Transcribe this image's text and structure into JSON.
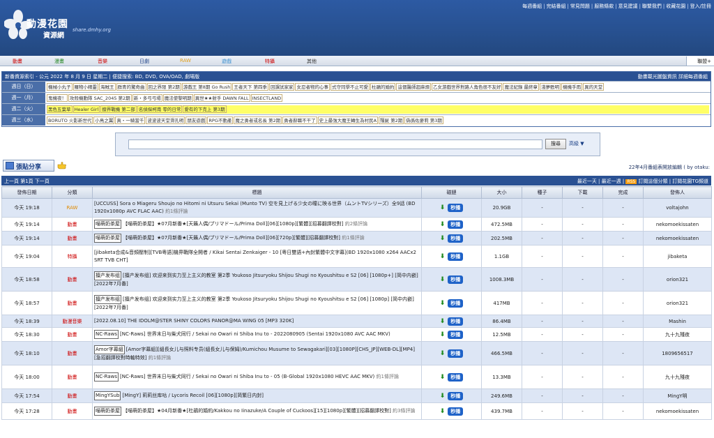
{
  "header": {
    "logo_main": "動漫花園",
    "logo_sub": "資源網",
    "logo_url": "share.dmhy.org",
    "links": [
      "每週番組",
      "完結番組",
      "常見問題",
      "服務條款",
      "意見建議",
      "聯繫我們",
      "收藏花園",
      "登入/註冊"
    ]
  },
  "categories": [
    "動畫",
    "漫畫",
    "音樂",
    "日劇",
    "RAW",
    "遊戲",
    "特攝",
    "其他"
  ],
  "category_colors": [
    "#cc0000",
    "#2a8a2a",
    "#cc0000",
    "#1a3f85",
    "#e0a020",
    "#3a8fd0",
    "#cc0000",
    "#333333"
  ],
  "nav_right": "聯盟+",
  "schedule": {
    "title": "新番資源索引 - 公元 2022 年 8 月 9 日 星期二 | 便捷搜索: BD, DVD, OVA/OAD, 劇場版",
    "title_right": "動畫載光圖盤資訊 詳細每週番組",
    "rows": [
      {
        "day": "週日（日）",
        "items": [
          "機械小丸子",
          "羅物小精靈",
          "海賊王",
          "群青的驚奇曲",
          "回之界限 第2期",
          "游戲王 第8期 Go Rush",
          "王者天下 第四季",
          "回課試家家",
          "女忍者物的心事",
          "式守同學不止可愛",
          "杜鵑的婚約",
          "這個醫師超麻煩",
          "乙女游戲世界對路人角色很不友好",
          "魔法紀錄 最終章",
          "淺夢甦明",
          "機機手雨",
          "異的天堂"
        ]
      },
      {
        "day": "週一（月）",
        "items": [
          "鬼機夜！",
          "攻殼機動隊 SAC_2045 第2期",
          "新・多弓弓場",
          "魔法使黎明期",
          "異世★★射手 DAWN FALL",
          "INSECTLAND"
        ]
      },
      {
        "day": "週二（火）",
        "items": [
          "黑色五葉草",
          "Healer Girl",
          "擅界戰機 第二部",
          "名偵探柯南 零的日常",
          "愛有的下克上 第3期"
        ]
      },
      {
        "day": "週三（水）",
        "items": [
          "BORUTO 火影新世代",
          "小鳥之翼",
          "真・一騎當千",
          "波波波天堂滑孔明",
          "朋友遊戲",
          "RPG不動產",
          "魔之勇者或名長 第2期",
          "勇者辭職不干了",
          "史上最強大魔王轉生為村民A",
          "殭屍 第2期",
          "偽僞佐麥莉 第3期"
        ]
      }
    ]
  },
  "search": {
    "button": "搜尋",
    "advanced": "高級 ▼",
    "placeholder": ""
  },
  "paste_button": "張貼分享",
  "notice": "22年4月番組表開放編輯 ( by otaku:",
  "pager": {
    "left": "上一頁 第1頁 下一頁",
    "right": [
      "最近一天",
      "最近一週",
      "訂閱這個分類",
      "訂閱花園TG頻道"
    ],
    "rss": "RSS"
  },
  "table": {
    "headers": [
      "發佈日期",
      "分類",
      "標題",
      "磁鏈",
      "大小",
      "種子",
      "下載",
      "完成",
      "發佈人"
    ],
    "seed_label": "秒播",
    "rows": [
      {
        "date": "今天 19:18",
        "cat": "RAW",
        "cat_class": "c-raw",
        "tag": "",
        "title": "[UCCUSS] Sora o Miageru Shoujo no Hitomi ni Utsuru Sekai (Munto TV) 空を見上げる少女の瞳に映る世界（ムントTVシリーズ）全9話 (BD 1920x1080p AVC FLAC AAC)",
        "comment": "約1條評論",
        "size": "20.9GB",
        "seed": "-",
        "dl": "-",
        "done": "-",
        "user": "voltajohn"
      },
      {
        "date": "今天 19:14",
        "cat": "動畫",
        "cat_class": "c-red",
        "tag": "喵萌奶茶屋",
        "title": "【喵萌奶茶屋】★07月新番★[天籟人偶/プリマドール/Prima Doll][06][1080p][繁體][招募翻譯校對]",
        "comment": "約2條評論",
        "size": "472.5MB",
        "seed": "-",
        "dl": "-",
        "done": "-",
        "user": "nekomoekissaten"
      },
      {
        "date": "今天 19:14",
        "cat": "動畫",
        "cat_class": "c-red",
        "tag": "喵萌奶茶屋",
        "title": "【喵萌奶茶屋】★07月新番★[天籟人偶/プリマドール/Prima Doll][06][720p][繁體][招募翻譯校對]",
        "comment": "約1條評論",
        "size": "202.5MB",
        "seed": "-",
        "dl": "-",
        "done": "-",
        "user": "nekomoekissaten"
      },
      {
        "date": "今天 19:04",
        "cat": "特攝",
        "cat_class": "c-tokusatsu",
        "tag": "",
        "title": "[jibaketa合成&音頻壓制][TVB粵語]機界戰隊全開者 / Kikai Sentai Zenkaiger - 10 [粵日雙語+內封繁體中文字幕](BD 1920x1080 x264 AACx2 SRT TVB CHT]",
        "comment": "",
        "size": "1.1GB",
        "seed": "-",
        "dl": "-",
        "done": "-",
        "user": "jibaketa"
      },
      {
        "date": "今天 18:58",
        "cat": "動畫",
        "cat_class": "c-red",
        "tag": "擅产发布组",
        "title": "[擅产发布组] 欢迎来到实力至上主义的教室 第2季 Youkoso Jitsuryoku Shijou Shugi no Kyoushitsu e S2 [06] [1080p+] [简中内嵌] [2022年7月番]",
        "comment": "",
        "size": "1008.3MB",
        "seed": "-",
        "dl": "-",
        "done": "-",
        "user": "orion321"
      },
      {
        "date": "今天 18:57",
        "cat": "動畫",
        "cat_class": "c-red",
        "tag": "擅产发布组",
        "title": "[擅产发布组] 欢迎来到实力至上主义的教室 第2季 Youkoso Jitsuryoku Shijou Shugi no Kyoushitsu e S2 [06] [1080p] [简中内嵌] [2022年7月番]",
        "comment": "",
        "size": "417MB",
        "seed": "-",
        "dl": "-",
        "done": "-",
        "user": "orion321"
      },
      {
        "date": "今天 18:39",
        "cat": "動漫音樂",
        "cat_class": "c-music",
        "tag": "",
        "title": "[2022.08.10] THE IDOLM@STER SHINY COLORS PANOR@MA WING 05 [MP3 320K]",
        "comment": "",
        "size": "86.4MB",
        "seed": "-",
        "dl": "-",
        "done": "-",
        "user": "Mashin"
      },
      {
        "date": "今天 18:30",
        "cat": "動畫",
        "cat_class": "c-red",
        "tag": "NC-Raws",
        "title": "[NC-Raws] 世界末日与柴犬同行 / Sekai no Owari ni Shiba Inu to - 2022080905 (Sentai 1920x1080 AVC AAC MKV)",
        "comment": "",
        "size": "12.5MB",
        "seed": "-",
        "dl": "-",
        "done": "-",
        "user": "九十九殘夜"
      },
      {
        "date": "今天 18:10",
        "cat": "動畫",
        "cat_class": "c-red",
        "tag": "Amor字幕組",
        "title": "[Amor字幕組][組長女儿与照料专员(組長女儿与保姆)/Kumichou Musume to Sewagakari][03][1080P][CHS_JP][WEB-DL][MP4][急招翻譯校對時軸特效]",
        "comment": "約1條評論",
        "size": "466.5MB",
        "seed": "-",
        "dl": "-",
        "done": "-",
        "user": "1809656517"
      },
      {
        "date": "今天 18:00",
        "cat": "動畫",
        "cat_class": "c-red",
        "tag": "NC-Raws",
        "title": "[NC-Raws] 世界末日与柴犬同行 / Sekai no Owari ni Shiba Inu to - 05 (B-Global 1920x1080 HEVC AAC MKV)",
        "comment": "約1條評論",
        "size": "13.3MB",
        "seed": "-",
        "dl": "-",
        "done": "-",
        "user": "九十九殘夜"
      },
      {
        "date": "今天 17:54",
        "cat": "動畫",
        "cat_class": "c-red",
        "tag": "MingYSub",
        "title": "[MingY] 莉莉丝库咕 / Lycoris Recoil [06][1080p][简繁日内封]",
        "comment": "",
        "size": "249.6MB",
        "seed": "-",
        "dl": "-",
        "done": "-",
        "user": "MingY明"
      },
      {
        "date": "今天 17:28",
        "cat": "動畫",
        "cat_class": "c-red",
        "tag": "喵萌奶茶屋",
        "title": "【喵萌奶茶屋】★04月新番★[杜鵑的婚約/Kakkou no Iinazuke/A Couple of Cuckoos][15][1080p][繁體][招募翻譯校對]",
        "comment": "約3條評論",
        "size": "439.7MB",
        "seed": "-",
        "dl": "-",
        "done": "-",
        "user": "nekomoekissaten"
      }
    ]
  }
}
